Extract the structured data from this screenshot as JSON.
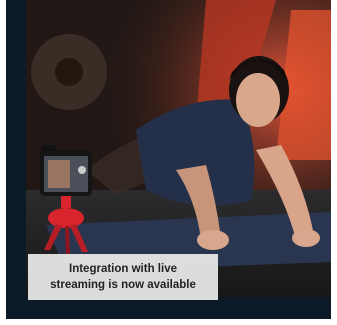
{
  "promo": {
    "caption_line1": "Integration with live",
    "caption_line2": "streaming is now available"
  },
  "colors": {
    "frame": "#0b1a26",
    "caption_bg": "#ebebeb",
    "caption_text": "#222222",
    "mat": "#2a3550",
    "tripod": "#d8242c"
  },
  "icons": {
    "camera": "camera-icon",
    "tripod": "tripod-icon"
  }
}
